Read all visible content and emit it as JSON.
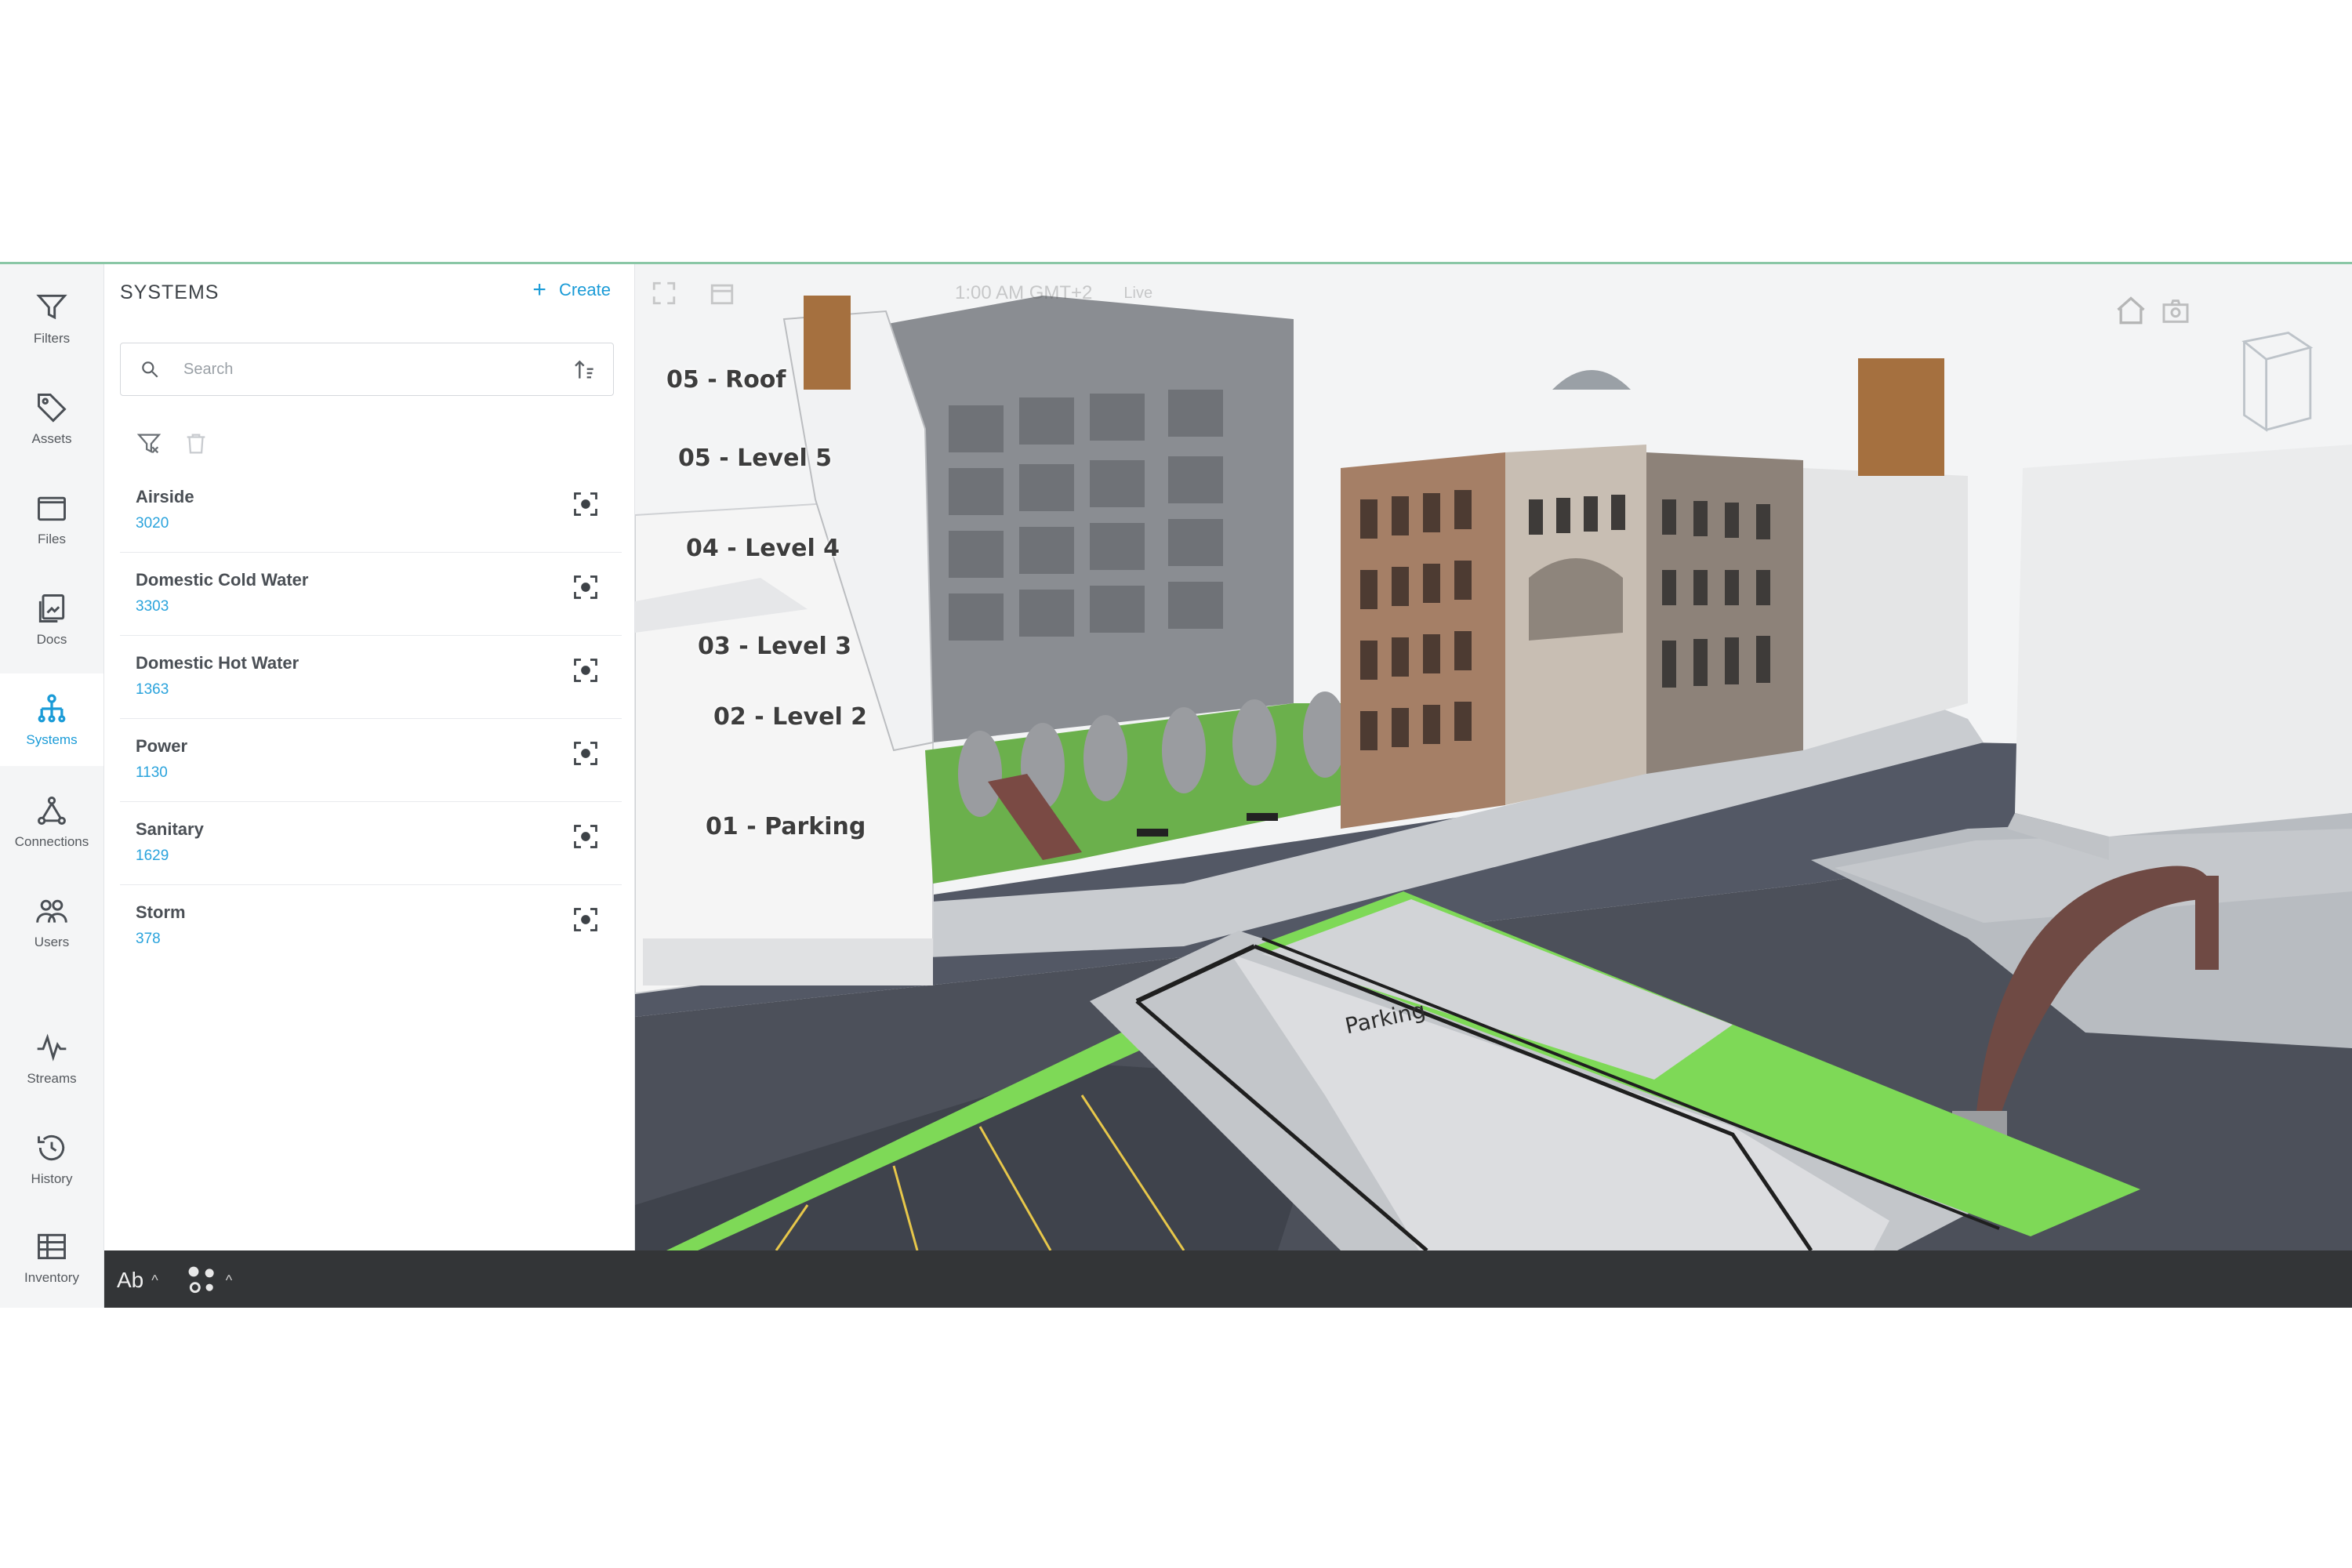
{
  "sidebar": {
    "items": [
      {
        "label": "Filters",
        "icon": "filter-icon"
      },
      {
        "label": "Assets",
        "icon": "tag-icon"
      },
      {
        "label": "Files",
        "icon": "folder-icon"
      },
      {
        "label": "Docs",
        "icon": "docs-icon"
      },
      {
        "label": "Systems",
        "icon": "hierarchy-icon",
        "active": true
      },
      {
        "label": "Connections",
        "icon": "connections-icon"
      },
      {
        "label": "Users",
        "icon": "users-icon"
      },
      {
        "label": "Streams",
        "icon": "pulse-icon"
      },
      {
        "label": "History",
        "icon": "history-icon"
      },
      {
        "label": "Inventory",
        "icon": "table-icon"
      }
    ]
  },
  "panel": {
    "title": "SYSTEMS",
    "create_label": "Create",
    "search_placeholder": "Search",
    "systems": [
      {
        "name": "Airside",
        "count": "3020"
      },
      {
        "name": "Domestic Cold Water",
        "count": "3303"
      },
      {
        "name": "Domestic Hot Water",
        "count": "1363"
      },
      {
        "name": "Power",
        "count": "1130"
      },
      {
        "name": "Sanitary",
        "count": "1629"
      },
      {
        "name": "Storm",
        "count": "378"
      }
    ]
  },
  "bottom_bar": {
    "text_toggle": "Ab"
  },
  "viewport": {
    "toolbar_time": "1:00 AM GMT+2",
    "toolbar_live": "Live",
    "level_labels": [
      {
        "id": "roof",
        "text": "05 - Roof"
      },
      {
        "id": "level5",
        "text": "05 - Level 5"
      },
      {
        "id": "level4",
        "text": "04 - Level 4"
      },
      {
        "id": "level3",
        "text": "03 - Level 3"
      },
      {
        "id": "level2",
        "text": "02 - Level 2"
      },
      {
        "id": "parking",
        "text": "01 - Parking"
      }
    ],
    "parking_sign": "Parking"
  },
  "colors": {
    "accent": "#1a9bd7",
    "bottom_bar": "#333537",
    "grass": "#7ed957",
    "road": "#4a4f5a"
  }
}
